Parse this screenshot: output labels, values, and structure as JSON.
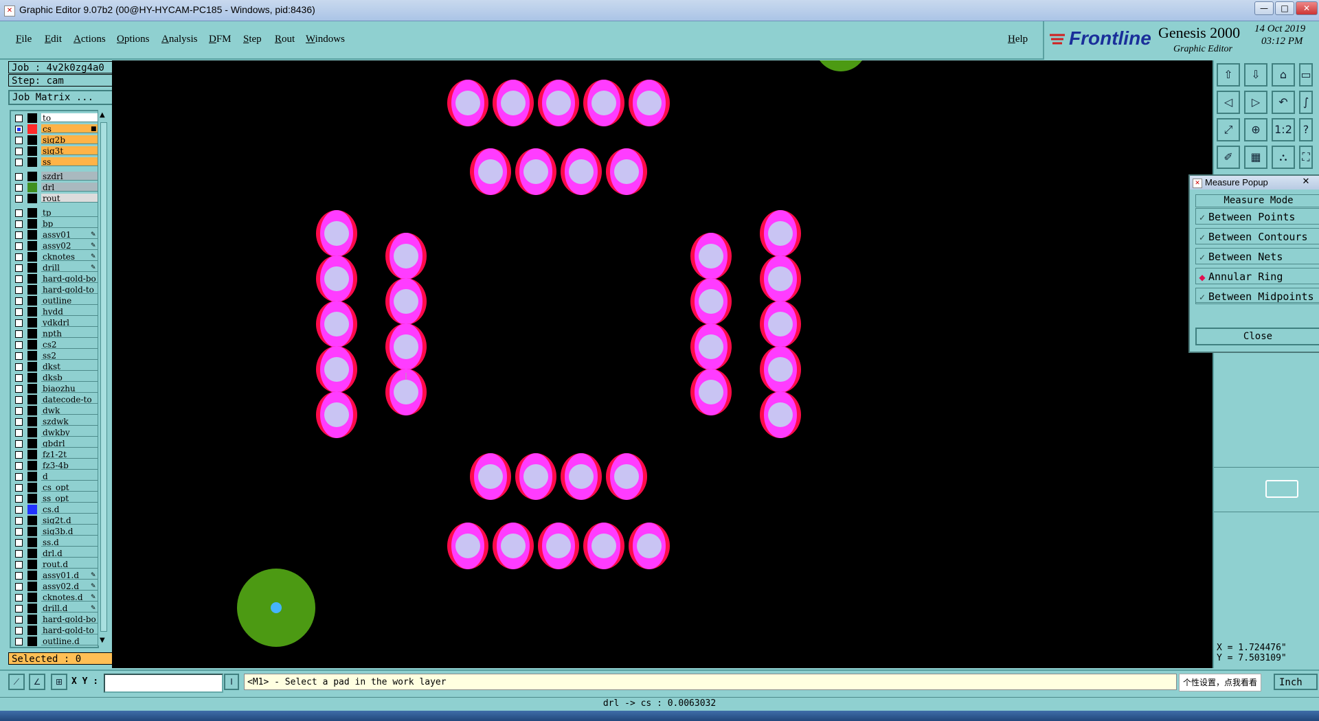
{
  "window": {
    "title": "Graphic Editor 9.07b2 (00@HY-HYCAM-PC185 - Windows, pid:8436)",
    "icon": "graphic-editor-icon",
    "controls": [
      "—",
      "□",
      "✕"
    ]
  },
  "menubar": {
    "items": [
      "File",
      "Edit",
      "Actions",
      "Options",
      "Analysis",
      "DFM",
      "Step",
      "Rout",
      "Windows"
    ],
    "help": "Help"
  },
  "brand": {
    "logo": "Frontline",
    "product": "Genesis 2000",
    "subtitle": "Graphic Editor",
    "date": "14 Oct 2019",
    "time": "03:12 PM"
  },
  "job": {
    "job_label": "Job : 4v2k0zg4a0",
    "step_label": "Step: cam",
    "matrix_button": "Job Matrix ..."
  },
  "layers": [
    {
      "name": "to",
      "color": "#000000",
      "bg": "#ffffff",
      "flag": ""
    },
    {
      "name": "cs",
      "color": "#ff2a2a",
      "bg": "#ffb347",
      "flag": "■",
      "active": true
    },
    {
      "name": "sig2b",
      "color": "#000000",
      "bg": "#ffb347",
      "flag": ""
    },
    {
      "name": "sig3t",
      "color": "#000000",
      "bg": "#ffb347",
      "flag": ""
    },
    {
      "name": "ss",
      "color": "#000000",
      "bg": "#ffb347",
      "flag": ""
    },
    {
      "name": "szdrl",
      "color": "#000000",
      "bg": "#a9b9bf",
      "flag": ""
    },
    {
      "name": "drl",
      "color": "#3f8f1f",
      "bg": "#a9b9bf",
      "flag": ""
    },
    {
      "name": "rout",
      "color": "#000000",
      "bg": "#dcdcdc",
      "flag": ""
    },
    {
      "name": "tp",
      "color": "#000000",
      "bg": "#8fd0d0",
      "flag": ""
    },
    {
      "name": "bp",
      "color": "#000000",
      "bg": "#8fd0d0",
      "flag": ""
    },
    {
      "name": "assy01",
      "color": "#000000",
      "bg": "#8fd0d0",
      "flag": "✎"
    },
    {
      "name": "assy02",
      "color": "#000000",
      "bg": "#8fd0d0",
      "flag": "✎"
    },
    {
      "name": "cknotes",
      "color": "#000000",
      "bg": "#8fd0d0",
      "flag": "✎"
    },
    {
      "name": "drill",
      "color": "#000000",
      "bg": "#8fd0d0",
      "flag": "✎"
    },
    {
      "name": "hard-gold-bo",
      "color": "#000000",
      "bg": "#8fd0d0",
      "flag": ""
    },
    {
      "name": "hard-gold-to",
      "color": "#000000",
      "bg": "#8fd0d0",
      "flag": ""
    },
    {
      "name": "outline",
      "color": "#000000",
      "bg": "#8fd0d0",
      "flag": ""
    },
    {
      "name": "hydd",
      "color": "#000000",
      "bg": "#8fd0d0",
      "flag": ""
    },
    {
      "name": "ydkdrl",
      "color": "#000000",
      "bg": "#8fd0d0",
      "flag": ""
    },
    {
      "name": "npth",
      "color": "#000000",
      "bg": "#8fd0d0",
      "flag": ""
    },
    {
      "name": "cs2",
      "color": "#000000",
      "bg": "#8fd0d0",
      "flag": ""
    },
    {
      "name": "ss2",
      "color": "#000000",
      "bg": "#8fd0d0",
      "flag": ""
    },
    {
      "name": "dkst",
      "color": "#000000",
      "bg": "#8fd0d0",
      "flag": ""
    },
    {
      "name": "dksb",
      "color": "#000000",
      "bg": "#8fd0d0",
      "flag": ""
    },
    {
      "name": "biaozhu",
      "color": "#000000",
      "bg": "#8fd0d0",
      "flag": ""
    },
    {
      "name": "datecode-to",
      "color": "#000000",
      "bg": "#8fd0d0",
      "flag": ""
    },
    {
      "name": "dwk",
      "color": "#000000",
      "bg": "#8fd0d0",
      "flag": ""
    },
    {
      "name": "szdwk",
      "color": "#000000",
      "bg": "#8fd0d0",
      "flag": ""
    },
    {
      "name": "dwkby",
      "color": "#000000",
      "bg": "#8fd0d0",
      "flag": ""
    },
    {
      "name": "gbdrl",
      "color": "#000000",
      "bg": "#8fd0d0",
      "flag": ""
    },
    {
      "name": "fz1-2t",
      "color": "#000000",
      "bg": "#8fd0d0",
      "flag": ""
    },
    {
      "name": "fz3-4b",
      "color": "#000000",
      "bg": "#8fd0d0",
      "flag": ""
    },
    {
      "name": "d",
      "color": "#000000",
      "bg": "#8fd0d0",
      "flag": ""
    },
    {
      "name": "cs_opt",
      "color": "#000000",
      "bg": "#8fd0d0",
      "flag": ""
    },
    {
      "name": "ss_opt",
      "color": "#000000",
      "bg": "#8fd0d0",
      "flag": ""
    },
    {
      "name": "cs.d",
      "color": "#2233ff",
      "bg": "#8fd0d0",
      "flag": ""
    },
    {
      "name": "sig2t.d",
      "color": "#000000",
      "bg": "#8fd0d0",
      "flag": ""
    },
    {
      "name": "sig3b.d",
      "color": "#000000",
      "bg": "#8fd0d0",
      "flag": ""
    },
    {
      "name": "ss.d",
      "color": "#000000",
      "bg": "#8fd0d0",
      "flag": ""
    },
    {
      "name": "drl.d",
      "color": "#000000",
      "bg": "#8fd0d0",
      "flag": ""
    },
    {
      "name": "rout.d",
      "color": "#000000",
      "bg": "#8fd0d0",
      "flag": ""
    },
    {
      "name": "assy01.d",
      "color": "#000000",
      "bg": "#8fd0d0",
      "flag": "✎"
    },
    {
      "name": "assy02.d",
      "color": "#000000",
      "bg": "#8fd0d0",
      "flag": "✎"
    },
    {
      "name": "cknotes.d",
      "color": "#000000",
      "bg": "#8fd0d0",
      "flag": "✎"
    },
    {
      "name": "drill.d",
      "color": "#000000",
      "bg": "#8fd0d0",
      "flag": "✎"
    },
    {
      "name": "hard-gold-bo",
      "color": "#000000",
      "bg": "#8fd0d0",
      "flag": ""
    },
    {
      "name": "hard-gold-to",
      "color": "#000000",
      "bg": "#8fd0d0",
      "flag": ""
    },
    {
      "name": "outline.d",
      "color": "#000000",
      "bg": "#8fd0d0",
      "flag": ""
    }
  ],
  "selected_label": "Selected : 0",
  "colors": {
    "pad_outer": "#ff0a4a",
    "pad_mid": "#ff3cff",
    "pad_hole": "#c9c4f3",
    "drill_green": "#4c9a13",
    "drill_hole": "#46b4ff",
    "panel": "#8fd0d0"
  },
  "measure_popup": {
    "title": "Measure Popup",
    "mode_header": "Measure Mode",
    "options": [
      {
        "label": "Between Points",
        "selected": false
      },
      {
        "label": "Between Contours",
        "selected": false
      },
      {
        "label": "Between Nets",
        "selected": false
      },
      {
        "label": "Annular Ring",
        "selected": true
      },
      {
        "label": "Between Midpoints",
        "selected": false
      }
    ],
    "close_label": "Close"
  },
  "toolbar_icons": [
    "layer-up-icon",
    "layer-down-icon",
    "home-icon",
    "panel-icon",
    "left-arrow-icon",
    "right-arrow-icon",
    "undo-icon",
    "symbol-icon",
    "zoom-fit-icon",
    "zoom-area-icon",
    "scale-1-2-icon",
    "help-icon",
    "snap-icon",
    "grid-icon",
    "net-icon",
    "route-icon"
  ],
  "toolbar_labels": [
    "⇧",
    "⇩",
    "⌂",
    "▭",
    "◁",
    "▷",
    "↶",
    "∫",
    "⤢",
    "⊕",
    "1:2",
    "?",
    "✐",
    "▦",
    "⛬",
    "⛶"
  ],
  "coords": {
    "x": "X = 1.724476\"",
    "y": "Y = 7.503109\""
  },
  "status": {
    "xy_label": "X Y :",
    "xy_value": "",
    "message": "<M1> - Select a pad in the work layer",
    "ime_hint": "个性设置，点我看看",
    "units": "Inch"
  },
  "footer": {
    "measurement": "drl -> cs : 0.0063032"
  }
}
